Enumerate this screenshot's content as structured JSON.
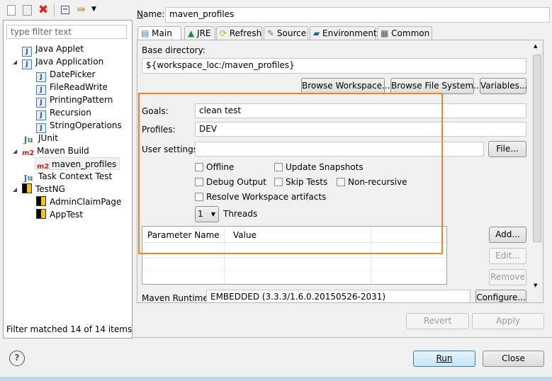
{
  "toolbar": {
    "icons": [
      "new-launch-config-icon",
      "duplicate-icon",
      "delete-icon",
      "collapse-all-icon",
      "filter-icon",
      "dropdown-icon"
    ]
  },
  "filter": {
    "placeholder": "type filter text",
    "status": "Filter matched 14 of 14 items"
  },
  "tree": [
    {
      "label": "Java Applet",
      "icon": "java-applet-icon",
      "level": 1,
      "expanded": null
    },
    {
      "label": "Java Application",
      "icon": "java-app-icon",
      "level": 1,
      "expanded": true
    },
    {
      "label": "DatePicker",
      "icon": "java-app-icon",
      "level": 2
    },
    {
      "label": "FileReadWrite",
      "icon": "java-app-icon",
      "level": 2
    },
    {
      "label": "PrintingPattern",
      "icon": "java-app-icon",
      "level": 2
    },
    {
      "label": "Recursion",
      "icon": "java-app-icon",
      "level": 2
    },
    {
      "label": "StringOperations",
      "icon": "java-app-icon",
      "level": 2
    },
    {
      "label": "JUnit",
      "icon": "junit-icon",
      "level": 1
    },
    {
      "label": "Maven Build",
      "icon": "maven-icon",
      "level": 1,
      "expanded": true
    },
    {
      "label": "maven_profiles",
      "icon": "maven-icon",
      "level": 2,
      "selected": true
    },
    {
      "label": "Task Context Test",
      "icon": "task-context-icon",
      "level": 1
    },
    {
      "label": "TestNG",
      "icon": "testng-icon",
      "level": 1,
      "expanded": true
    },
    {
      "label": "AdminClaimPage",
      "icon": "testng-icon",
      "level": 2
    },
    {
      "label": "AppTest",
      "icon": "testng-icon",
      "level": 2
    }
  ],
  "name": {
    "label": "Name:",
    "value": "maven_profiles"
  },
  "tabs": [
    "Main",
    "JRE",
    "Refresh",
    "Source",
    "Environment",
    "Common"
  ],
  "main": {
    "base_dir_label": "Base directory:",
    "base_dir_value": "${workspace_loc:/maven_profiles}",
    "browse_workspace": "Browse Workspace...",
    "browse_fs": "Browse File System...",
    "variables": "Variables...",
    "goals_label": "Goals:",
    "goals_value": "clean test",
    "profiles_label": "Profiles:",
    "profiles_value": "DEV",
    "user_settings_label": "User settings:",
    "user_settings_value": "",
    "file_button": "File...",
    "checkboxes": {
      "offline": "Offline",
      "update_snapshots": "Update Snapshots",
      "debug_output": "Debug Output",
      "skip_tests": "Skip Tests",
      "non_recursive": "Non-recursive",
      "resolve_workspace": "Resolve Workspace artifacts"
    },
    "threads_value": "1",
    "threads_label": "Threads",
    "table_headers": [
      "Parameter Name",
      "Value"
    ],
    "add": "Add...",
    "edit": "Edit...",
    "remove": "Remove",
    "runtime_label": "Maven Runtime:",
    "runtime_value": "EMBEDDED (3.3.3/1.6.0.20150526-2031)",
    "configure": "Configure..."
  },
  "buttons": {
    "revert": "Revert",
    "apply": "Apply",
    "run": "Run",
    "close": "Close",
    "help": "?"
  },
  "colors": {
    "highlight_box": "#f0832a",
    "run_button": "#cfe8f8"
  }
}
